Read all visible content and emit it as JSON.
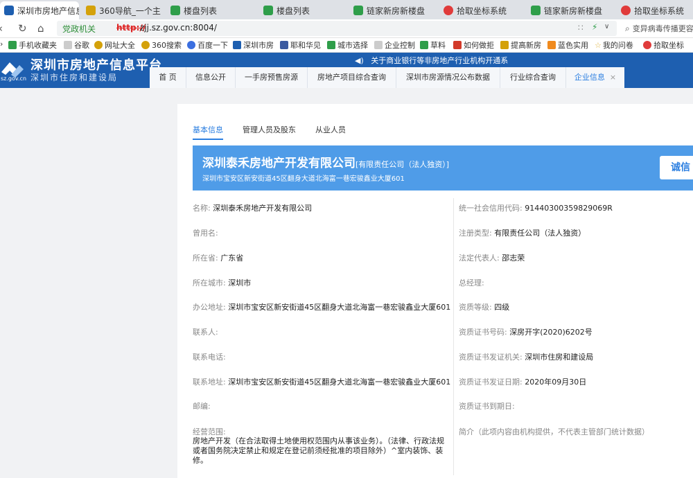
{
  "browser": {
    "tabs": [
      {
        "label": "深圳市房地产信息",
        "color": "#1e5fb0"
      },
      {
        "label": "360导航_一个主",
        "color": "#d4a10a"
      },
      {
        "label": "楼盘列表",
        "color": "#2f9e4a"
      },
      {
        "label": "楼盘列表",
        "color": "#2f9e4a"
      },
      {
        "label": "链家新房新楼盘",
        "color": "#2f9e4a"
      },
      {
        "label": "拾取坐标系统",
        "color": "#e03b3b"
      },
      {
        "label": "链家新房新楼盘",
        "color": "#2f9e4a"
      },
      {
        "label": "拾取坐标系统",
        "color": "#e03b3b"
      }
    ],
    "tab_close": "×",
    "gov_badge": "党政机关",
    "url_scheme": "http://",
    "url": "zjj.sz.gov.cn:8004/",
    "search_text": "变异病毒传播更容",
    "bookmarks": [
      {
        "label": "手机收藏夹",
        "color": "#2f9e4a"
      },
      {
        "label": "谷歌",
        "color": "#cccccc"
      },
      {
        "label": "网址大全",
        "color": "#d4a10a"
      },
      {
        "label": "360搜索",
        "color": "#d4a10a"
      },
      {
        "label": "百度一下",
        "color": "#3b6fe0"
      },
      {
        "label": "深圳市房",
        "color": "#1e5fb0"
      },
      {
        "label": "耶和华见",
        "color": "#3b5aa0"
      },
      {
        "label": "城市选择",
        "color": "#2f9e4a"
      },
      {
        "label": "企业控制",
        "color": "#cccccc"
      },
      {
        "label": "草料",
        "color": "#2f9e4a"
      },
      {
        "label": "如何做拒",
        "color": "#d23a2a"
      },
      {
        "label": "提高新房",
        "color": "#d4a10a"
      },
      {
        "label": "蓝色实用",
        "color": "#f08a1e"
      },
      {
        "label": "我的问卷",
        "color": "#e0b23a"
      },
      {
        "label": "拾取坐标",
        "color": "#e03b3b"
      }
    ]
  },
  "site": {
    "logo_text": "sz.gov.cn",
    "title": "深圳市房地产信息平台",
    "subtitle": "深圳市住房和建设局",
    "notice": "关于商业银行等非房地产行业机构开通系",
    "nav": [
      "首 页",
      "信息公开",
      "一手房预售房源",
      "房地产项目综合查询",
      "深圳市房源情况公布数据",
      "行业综合查询",
      "企业信息"
    ],
    "nav_close": "×"
  },
  "subtabs": [
    "基本信息",
    "管理人员及股东",
    "从业人员"
  ],
  "company": {
    "name": "深圳泰禾房地产开发有限公司",
    "type": "[有限责任公司（法人独资）]",
    "address": "深圳市宝安区新安街道45区翻身大道北海富一巷宏骏鑫业大厦601",
    "credit_button": "诚信"
  },
  "fields_left": [
    {
      "label": "名称:",
      "value": "深圳泰禾房地产开发有限公司"
    },
    {
      "label": "曾用名:",
      "value": ""
    },
    {
      "label": "所在省:",
      "value": "广东省"
    },
    {
      "label": "所在城市:",
      "value": "深圳市"
    },
    {
      "label": "办公地址:",
      "value": "深圳市宝安区新安街道45区翻身大道北海富一巷宏骏鑫业大厦601"
    },
    {
      "label": "联系人:",
      "value": ""
    },
    {
      "label": "联系电话:",
      "value": ""
    },
    {
      "label": "联系地址:",
      "value": "深圳市宝安区新安街道45区翻身大道北海富一巷宏骏鑫业大厦601"
    },
    {
      "label": "邮编:",
      "value": ""
    },
    {
      "label": "经营范围:",
      "value": ""
    }
  ],
  "fields_right": [
    {
      "label": "统一社会信用代码:",
      "value": "91440300359829069R"
    },
    {
      "label": "注册类型:",
      "value": "有限责任公司（法人独资）"
    },
    {
      "label": "法定代表人:",
      "value": "邵志荣"
    },
    {
      "label": "总经理:",
      "value": ""
    },
    {
      "label": "资质等级:",
      "value": "四级"
    },
    {
      "label": "资质证书号码:",
      "value": "深房开字(2020)6202号"
    },
    {
      "label": "资质证书发证机关:",
      "value": "深圳市住房和建设局"
    },
    {
      "label": "资质证书发证日期:",
      "value": "2020年09月30日"
    },
    {
      "label": "资质证书到期日:",
      "value": ""
    },
    {
      "label": "简介（此项内容由机构提供，不代表主管部门统计数据）",
      "value": ""
    }
  ],
  "business_scope": "房地产开发（在合法取得土地使用权范围内从事该业务）。（法律、行政法规或者国务院决定禁止和规定在登记前须经批准的项目除外）^室内装饰、装修。"
}
